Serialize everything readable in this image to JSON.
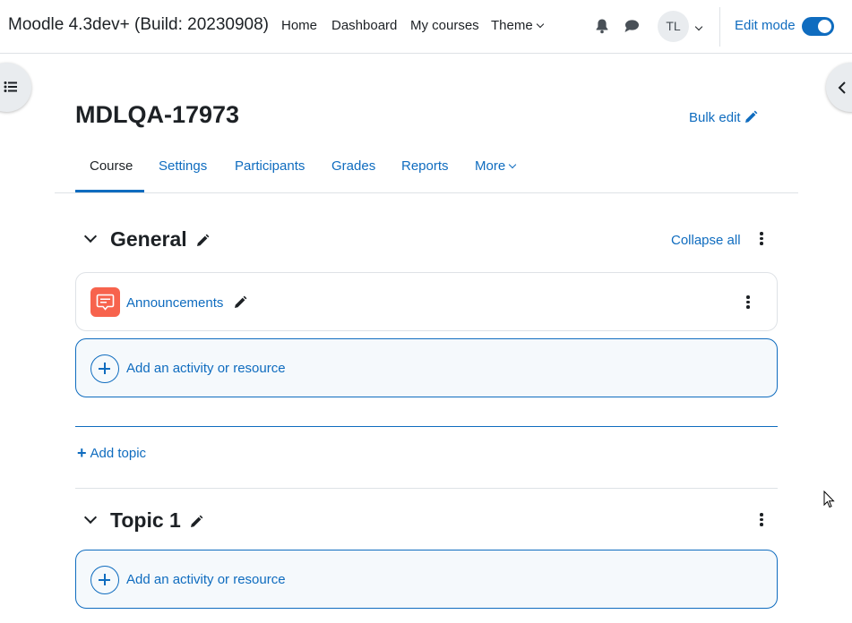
{
  "navbar": {
    "site_name": "Moodle 4.3dev+ (Build: 20230908)",
    "links": {
      "home": "Home",
      "dashboard": "Dashboard",
      "my_courses": "My courses",
      "theme": "Theme"
    },
    "user_initials": "TL",
    "edit_mode_label": "Edit mode",
    "edit_mode_on": true,
    "icons": [
      "bell-icon",
      "chat-icon",
      "chevron-down-icon"
    ]
  },
  "page": {
    "title": "MDLQA-17973",
    "bulk_edit_label": "Bulk edit"
  },
  "tabs": [
    {
      "label": "Course",
      "active": true
    },
    {
      "label": "Settings",
      "active": false
    },
    {
      "label": "Participants",
      "active": false
    },
    {
      "label": "Grades",
      "active": false
    },
    {
      "label": "Reports",
      "active": false
    },
    {
      "label": "More",
      "active": false
    }
  ],
  "course": {
    "collapse_all_label": "Collapse all",
    "sections": [
      {
        "title": "General",
        "activities": [
          {
            "name": "Announcements",
            "type": "forum"
          }
        ],
        "add_activity_label": "Add an activity or resource"
      },
      {
        "title": "Topic 1",
        "activities": [],
        "add_activity_label": "Add an activity or resource"
      }
    ],
    "add_topic_label": "Add topic"
  },
  "colors": {
    "link": "#0f6cbf",
    "text": "#1d2125",
    "forum_icon": "#f7634d",
    "border": "#dee2e6"
  }
}
